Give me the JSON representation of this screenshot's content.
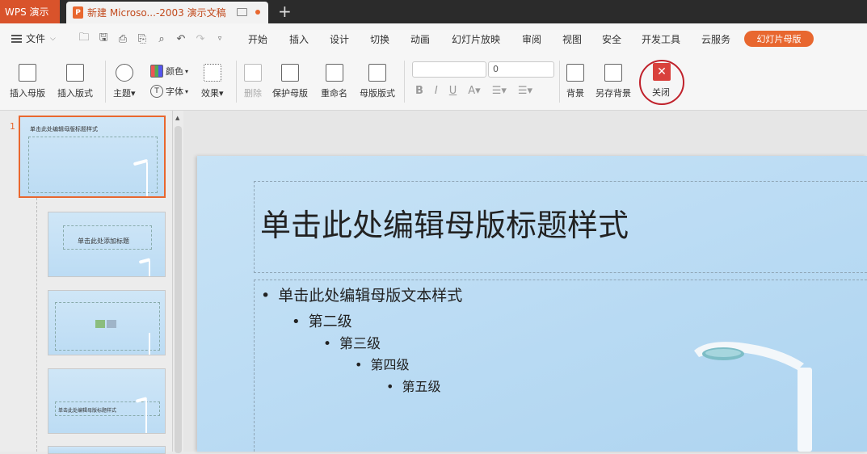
{
  "titlebar": {
    "app_tab": "WPS 演示",
    "doc_tab": "新建 Microso...-2003 演示文稿",
    "doc_icon": "P",
    "new_tab": "+"
  },
  "menu": {
    "file": "文件",
    "items": [
      "开始",
      "插入",
      "设计",
      "切换",
      "动画",
      "幻灯片放映",
      "审阅",
      "视图",
      "安全",
      "开发工具",
      "云服务"
    ],
    "active": "幻灯片母版"
  },
  "toolbar": {
    "insert_master": "插入母版",
    "insert_layout": "插入版式",
    "theme": "主题",
    "color": "颜色",
    "font": "字体",
    "effect": "效果",
    "delete": "删除",
    "protect_master": "保护母版",
    "rename": "重命名",
    "master_layout": "母版版式",
    "font_size": "0",
    "background": "背景",
    "save_background": "另存背景",
    "close": "关闭"
  },
  "thumbnails": {
    "slide_number": "1",
    "t1_title": "单击此处编辑母版标题样式",
    "t2_title": "单击此处添加标题",
    "t4_title": "单击此处编辑母版标题样式"
  },
  "slide": {
    "title": "单击此处编辑母版标题样式",
    "levels": [
      "单击此处编辑母版文本样式",
      "第二级",
      "第三级",
      "第四级",
      "第五级"
    ]
  },
  "colors": {
    "accent": "#e8672f",
    "wps_tab": "#d9532b",
    "close_red": "#c0212b"
  }
}
